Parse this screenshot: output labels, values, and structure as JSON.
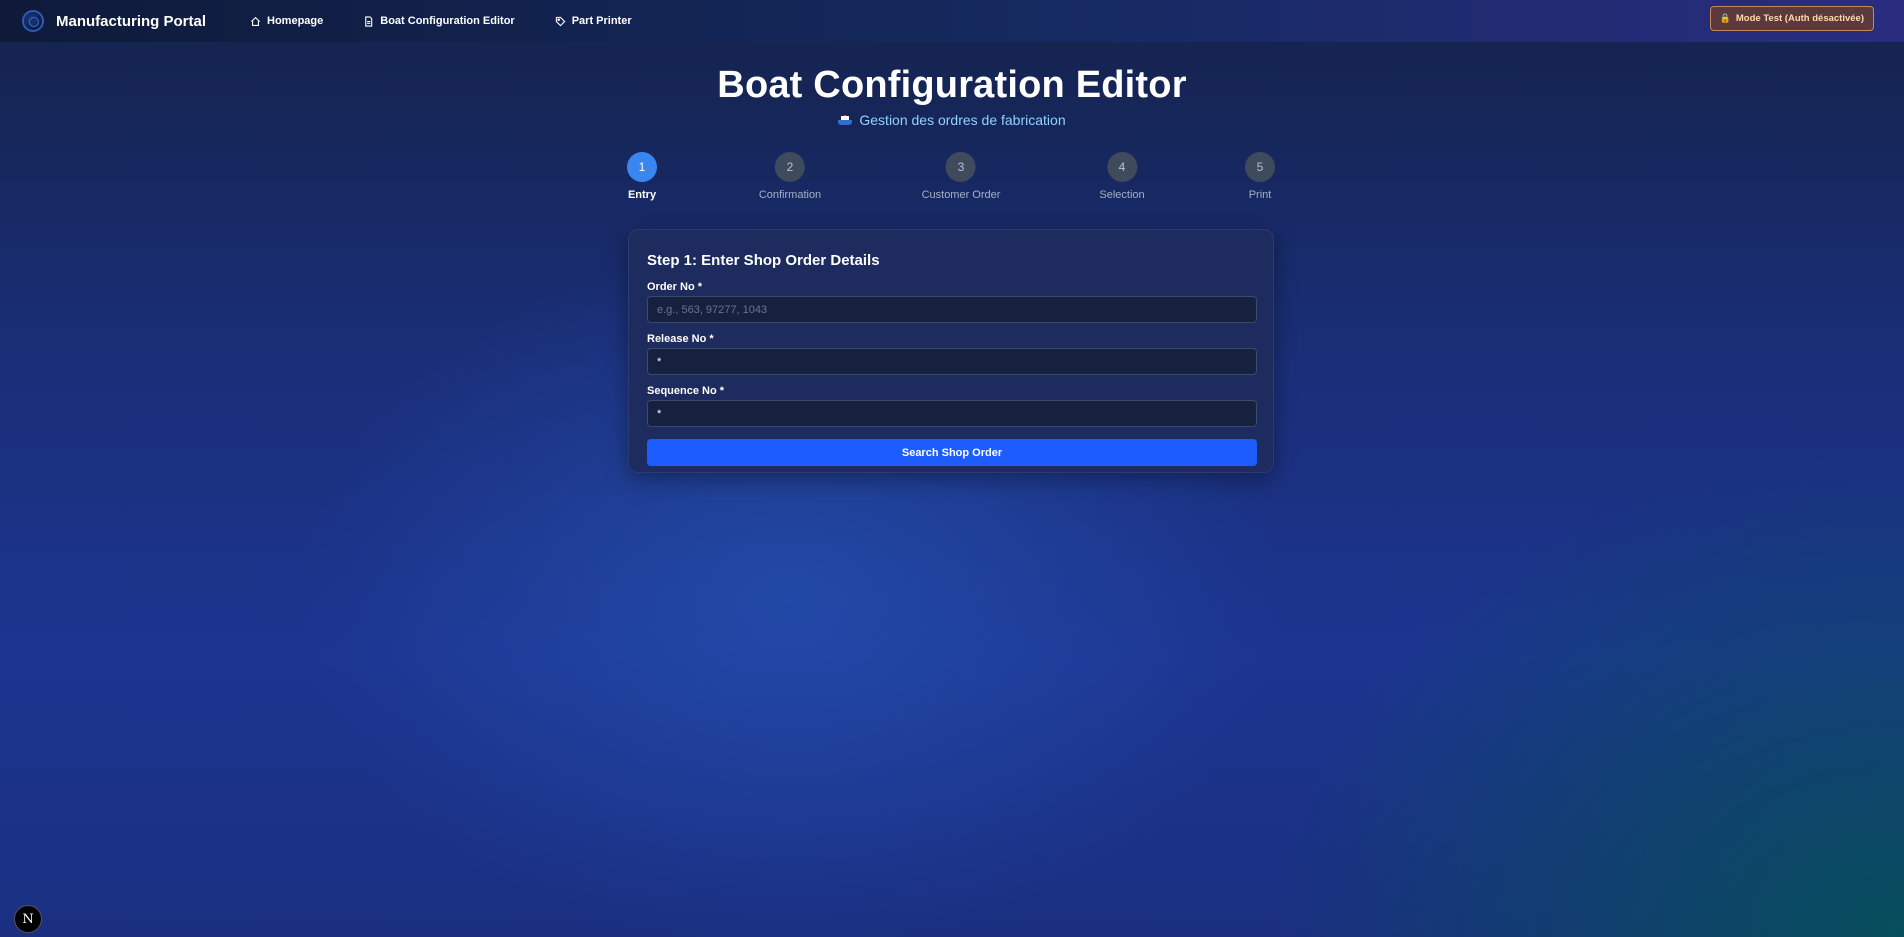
{
  "navbar": {
    "brand": "Manufacturing Portal",
    "links": [
      {
        "label": "Homepage",
        "icon": "home-icon"
      },
      {
        "label": "Boat Configuration Editor",
        "icon": "document-icon"
      },
      {
        "label": "Part Printer",
        "icon": "tag-icon"
      }
    ],
    "mode_badge": "Mode Test (Auth désactivée)",
    "mode_badge_icon": "lock-icon"
  },
  "header": {
    "title": "Boat Configuration Editor",
    "subtitle": "Gestion des ordres de fabrication",
    "subtitle_icon": "ship-icon"
  },
  "stepper": {
    "active_step": 1,
    "steps": [
      {
        "number": "1",
        "label": "Entry"
      },
      {
        "number": "2",
        "label": "Confirmation"
      },
      {
        "number": "3",
        "label": "Customer Order"
      },
      {
        "number": "4",
        "label": "Selection"
      },
      {
        "number": "5",
        "label": "Print"
      }
    ]
  },
  "form": {
    "title": "Step 1: Enter Shop Order Details",
    "order_no": {
      "label": "Order No *",
      "value": "",
      "placeholder": "e.g., 563, 97277, 1043"
    },
    "release_no": {
      "label": "Release No *",
      "value": "*",
      "placeholder": ""
    },
    "sequence_no": {
      "label": "Sequence No *",
      "value": "*",
      "placeholder": ""
    },
    "submit_label": "Search Shop Order"
  },
  "dev_badge": "N",
  "colors": {
    "accent": "#1d5cff",
    "step_active": "#3a86f0",
    "subtitle": "#8fd3ff",
    "mode_badge_bg": "#5b3a3e"
  }
}
